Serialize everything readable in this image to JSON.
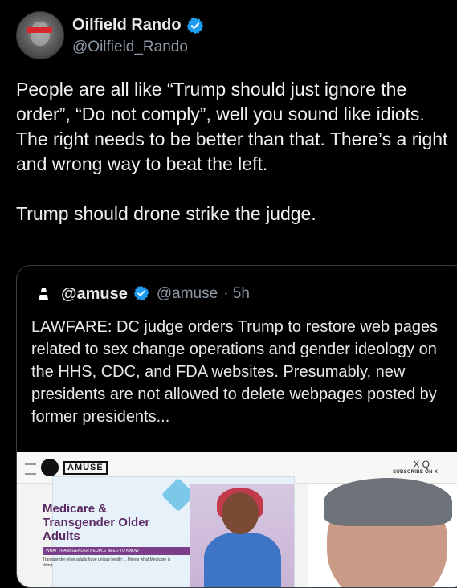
{
  "author": {
    "name": "Oilfield Rando",
    "handle": "@Oilfield_Rando",
    "verified_color": "#1d9bf0"
  },
  "tweet": {
    "text": "People are all like “Trump should just ignore the order”, “Do not comply”, well you sound like idiots. The right needs to be better than that. There’s a right and wrong way to beat the left.\n\nTrump should drone strike the judge."
  },
  "quote": {
    "name": "@amuse",
    "handle": "@amuse",
    "time": "· 5h",
    "text": "LAWFARE: DC judge orders Trump to restore web pages related to sex change operations and gender ideology on the HHS, CDC, and FDA websites. Presumably, new presidents are not allowed to delete webpages posted by former presidents...",
    "media": {
      "site_logo": "AMUSE",
      "top_right_icons": "X Q",
      "subscribe": "SUBSCRIBE ON X",
      "headline": "Medicare & Transgender Older Adults",
      "band": "WHAT TRANSGENDER PEOPLE NEED TO KNOW",
      "small": "Transgender older adults have unique health ... Here's what Medicare is doing"
    }
  }
}
